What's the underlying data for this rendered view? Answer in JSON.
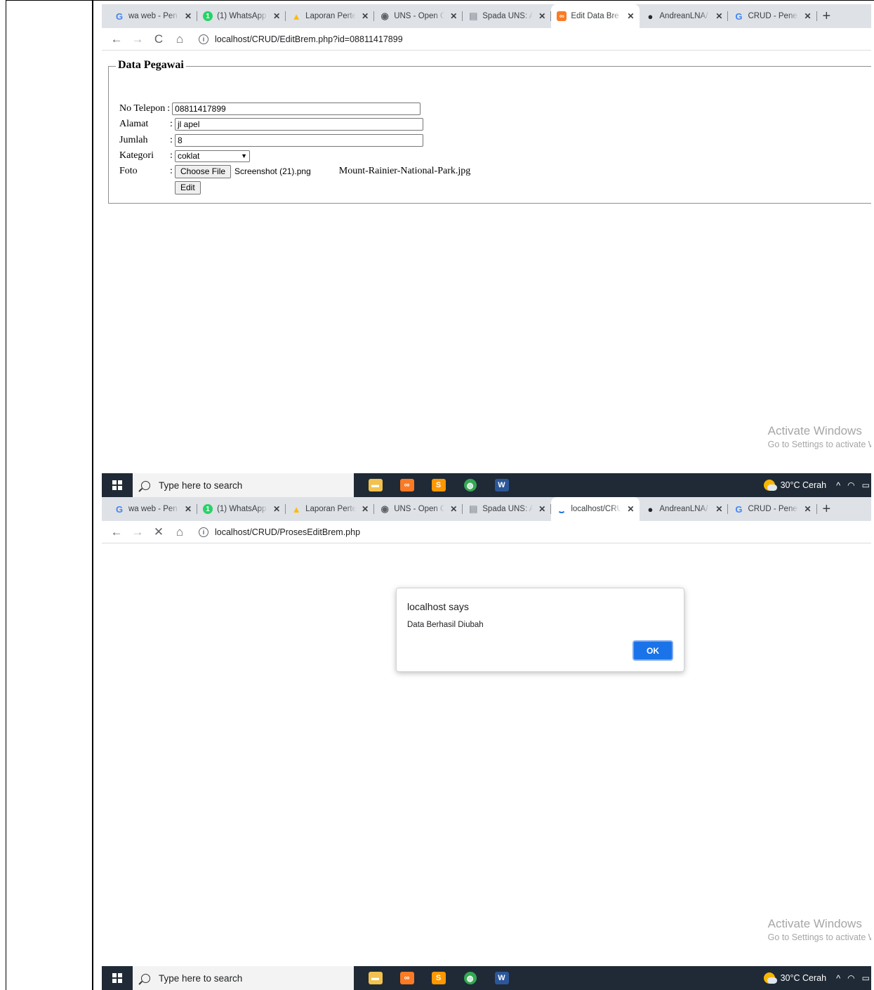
{
  "tabs_1": [
    {
      "label": "wa web - Pen",
      "icon": "google-icon",
      "color": "#4285f4",
      "glyph": "G"
    },
    {
      "label": "(1) WhatsApp",
      "icon": "whatsapp-icon",
      "color": "#25d366",
      "glyph": "1"
    },
    {
      "label": "Laporan Perte",
      "icon": "drive-icon",
      "color": "#fbbc04",
      "glyph": "▲"
    },
    {
      "label": "UNS - Open C",
      "icon": "globe-icon",
      "color": "#5f6368",
      "glyph": "◉"
    },
    {
      "label": "Spada UNS: A",
      "icon": "spada-icon",
      "color": "#9aa0a6",
      "glyph": "▤"
    },
    {
      "label": "Edit Data Bre",
      "icon": "xampp-icon",
      "color": "#fb7a24",
      "glyph": "∞",
      "active": true
    },
    {
      "label": "AndreanLNA/",
      "icon": "github-icon",
      "color": "#24292e",
      "glyph": "●"
    },
    {
      "label": "CRUD - Penel",
      "icon": "google-icon",
      "color": "#4285f4",
      "glyph": "G"
    }
  ],
  "tabs_2": [
    {
      "label": "wa web - Pen",
      "icon": "google-icon",
      "color": "#4285f4",
      "glyph": "G"
    },
    {
      "label": "(1) WhatsApp",
      "icon": "whatsapp-icon",
      "color": "#25d366",
      "glyph": "1"
    },
    {
      "label": "Laporan Perte",
      "icon": "drive-icon",
      "color": "#fbbc04",
      "glyph": "▲"
    },
    {
      "label": "UNS - Open C",
      "icon": "globe-icon",
      "color": "#5f6368",
      "glyph": "◉"
    },
    {
      "label": "Spada UNS: A",
      "icon": "spada-icon",
      "color": "#9aa0a6",
      "glyph": "▤"
    },
    {
      "label": "localhost/CRU",
      "icon": "loading-icon",
      "color": "#1a73e8",
      "glyph": "",
      "active": true
    },
    {
      "label": "AndreanLNA/",
      "icon": "github-icon",
      "color": "#24292e",
      "glyph": "●"
    },
    {
      "label": "CRUD - Penel",
      "icon": "google-icon",
      "color": "#4285f4",
      "glyph": "G"
    }
  ],
  "shot1": {
    "url": "localhost/CRUD/EditBrem.php?id=08811417899",
    "form": {
      "legend": "Data Pegawai",
      "no_telepon_label": "No Telepon",
      "no_telepon_value": "08811417899",
      "alamat_label": "Alamat",
      "alamat_value": "jl apel",
      "jumlah_label": "Jumlah",
      "jumlah_value": "8",
      "kategori_label": "Kategori",
      "kategori_value": "coklat",
      "foto_label": "Foto",
      "choose_file_label": "Choose File",
      "chosen_file": "Screenshot (21).png",
      "current_file": "Mount-Rainier-National-Park.jpg",
      "edit_label": "Edit",
      "colon": ":"
    }
  },
  "shot2": {
    "url": "localhost/CRUD/ProsesEditBrem.php",
    "dialog": {
      "title": "localhost says",
      "message": "Data Berhasil Diubah",
      "ok_label": "OK"
    }
  },
  "watermark": {
    "line1": "Activate Windows",
    "line2": "Go to Settings to activate Windows."
  },
  "taskbar": {
    "search_placeholder": "Type here to search",
    "weather": "30°C  Cerah",
    "apps": [
      {
        "name": "file-explorer-icon",
        "color": "#f2c14e",
        "glyph": "▬"
      },
      {
        "name": "xampp-icon",
        "color": "#fb7a24",
        "glyph": "∞"
      },
      {
        "name": "sublime-icon",
        "color": "#ff9800",
        "glyph": "S"
      },
      {
        "name": "chrome-icon",
        "color": "#34a853",
        "glyph": "◍"
      },
      {
        "name": "word-icon",
        "color": "#2b579a",
        "glyph": "W"
      }
    ]
  },
  "nav_icons": {
    "back": "←",
    "forward": "→",
    "reload": "C",
    "stop": "✕",
    "home": "⌂",
    "new_tab": "+",
    "close": "✕"
  }
}
